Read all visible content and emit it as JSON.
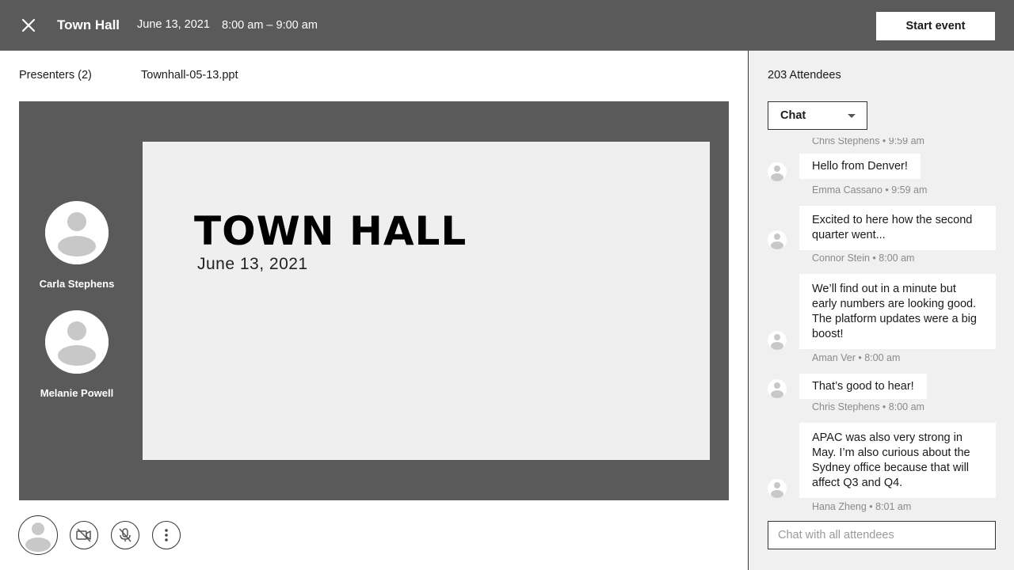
{
  "header": {
    "close_icon": "close-icon",
    "title": "Town Hall",
    "date": "June 13, 2021",
    "time": "8:00 am – 9:00 am",
    "start_button": "Start event",
    "background": "#5a5a5a"
  },
  "main": {
    "tabs": [
      {
        "label": "Presenters (2)"
      },
      {
        "label": "Townhall-05-13.ppt"
      }
    ],
    "presenters": [
      {
        "name": "Carla Stephens",
        "icon": "person-icon"
      },
      {
        "name": "Melanie Powell",
        "icon": "person-icon"
      }
    ],
    "slide": {
      "title": "TOWN HALL",
      "date": "June 13, 2021"
    },
    "controls": [
      {
        "icon": "self-avatar-icon"
      },
      {
        "icon": "video-off-icon"
      },
      {
        "icon": "mic-off-icon"
      },
      {
        "icon": "more-vertical-icon"
      }
    ]
  },
  "sidebar": {
    "attendees": "203 Attendees",
    "chat_select": "Chat",
    "messages": [
      {
        "text": "",
        "meta": "Chris Stephens • 9:59 am"
      },
      {
        "text": "Hello from Denver!",
        "meta": "Emma Cassano • 9:59 am"
      },
      {
        "text": "Excited to here how the second quarter went...",
        "meta": "Connor Stein • 8:00 am"
      },
      {
        "text": "We’ll find out in a minute but early numbers are looking good. The platform updates were a big boost!",
        "meta": "Aman Ver • 8:00 am"
      },
      {
        "text": "That’s good to hear!",
        "meta": "Chris Stephens • 8:00 am"
      },
      {
        "text": "APAC was also very strong in May. I’m also curious about the Sydney office because that will affect Q3 and Q4.",
        "meta": "Hana Zheng • 8:01 am"
      }
    ],
    "chat_placeholder": "Chat with all attendees",
    "background": "#f0f0f0"
  }
}
